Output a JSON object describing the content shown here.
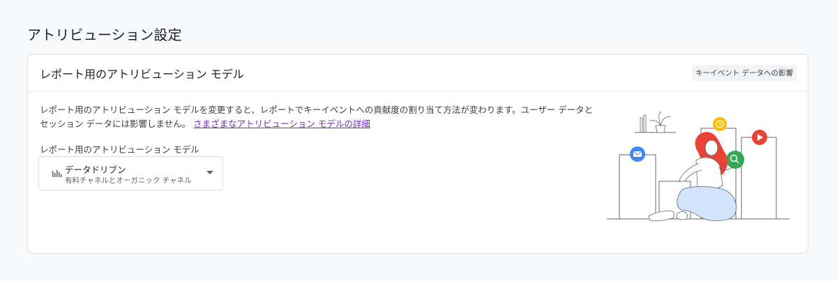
{
  "page": {
    "title": "アトリビューション設定"
  },
  "card": {
    "title": "レポート用のアトリビューション モデル",
    "chip_label": "キーイベント データへの影響",
    "description": "レポート用のアトリビューション モデルを変更すると、レポートでキーイベントへの貢献度の割り当て方法が変わります。ユーザー データとセッション データには影響しません。",
    "description_link": "さまざまなアトリビューション モデルの詳細",
    "field_label": "レポート用のアトリビューション モデル",
    "select": {
      "value": "データドリブン",
      "subtext": "有料チャネルとオーガニック チャネル",
      "icon": "bar-chart-icon"
    }
  },
  "illustration": {
    "name": "woman-with-floating-icons",
    "icons": [
      "email-icon",
      "clock-icon",
      "play-icon",
      "search-icon"
    ],
    "colors": {
      "email": "#4285f4",
      "clock": "#fbbc04",
      "play": "#ea4335",
      "search": "#34a853",
      "hair": "#ea4335",
      "pants": "#d2e3fc"
    }
  }
}
